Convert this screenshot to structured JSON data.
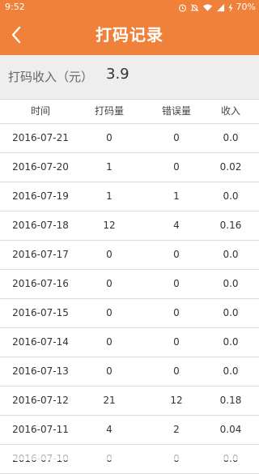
{
  "status_bar": {
    "time": "9:52",
    "battery": "70%"
  },
  "header": {
    "title": "打码记录",
    "back_icon": "chevron-left-icon"
  },
  "summary": {
    "label": "打码收入（元）",
    "value": "3.9"
  },
  "table": {
    "columns": [
      "时间",
      "打码量",
      "错误量",
      "收入"
    ],
    "rows": [
      [
        "2016-07-21",
        "0",
        "0",
        "0.0"
      ],
      [
        "2016-07-20",
        "1",
        "0",
        "0.02"
      ],
      [
        "2016-07-19",
        "1",
        "1",
        "0.0"
      ],
      [
        "2016-07-18",
        "12",
        "4",
        "0.16"
      ],
      [
        "2016-07-17",
        "0",
        "0",
        "0.0"
      ],
      [
        "2016-07-16",
        "0",
        "0",
        "0.0"
      ],
      [
        "2016-07-15",
        "0",
        "0",
        "0.0"
      ],
      [
        "2016-07-14",
        "0",
        "0",
        "0.0"
      ],
      [
        "2016-07-13",
        "0",
        "0",
        "0.0"
      ],
      [
        "2016-07-12",
        "21",
        "12",
        "0.18"
      ],
      [
        "2016-07-11",
        "4",
        "2",
        "0.04"
      ],
      [
        "2016-07-10",
        "0",
        "0",
        "0.0"
      ]
    ]
  },
  "colors": {
    "accent": "#f0813a",
    "summary_bg": "#eeeeee",
    "divider": "#dcdcdc"
  }
}
